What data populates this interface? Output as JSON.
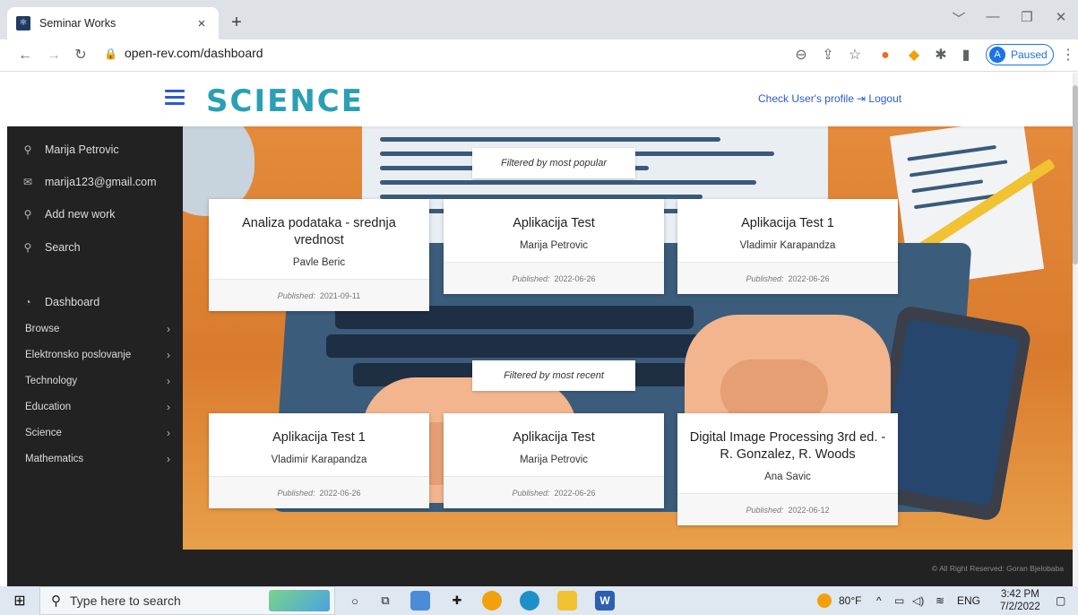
{
  "browser": {
    "tab_title": "Seminar Works",
    "tab_close": "×",
    "new_tab": "+",
    "window_controls": [
      "﹀",
      "—",
      "❐",
      "✕"
    ],
    "url": "open-rev.com/dashboard",
    "profile_initial": "A",
    "profile_status": "Paused",
    "icons": [
      "back-arrow-icon",
      "forward-arrow-icon",
      "reload-icon",
      "lock-icon",
      "zoom-icon",
      "share-icon",
      "star-icon",
      "extension-icon",
      "puzzle-icon",
      "sidebar-icon",
      "menu-dots-icon"
    ]
  },
  "header": {
    "logo": "SCIENCE",
    "profile_link": "Check User's profile",
    "logout_link": "Logout"
  },
  "sidebar": {
    "user": [
      {
        "icon": "link-icon",
        "label": "Marija Petrovic"
      },
      {
        "icon": "mail-icon",
        "label": "marija123@gmail.com"
      },
      {
        "icon": "link-icon",
        "label": "Add new work"
      },
      {
        "icon": "search-icon",
        "label": "Search"
      }
    ],
    "dashboard": "Dashboard",
    "categories": [
      {
        "label": "Browse",
        "chevron": "›"
      },
      {
        "label": "Elektronsko poslovanje",
        "chevron": "›"
      },
      {
        "label": "Technology",
        "chevron": "›"
      },
      {
        "label": "Education",
        "chevron": "›"
      },
      {
        "label": "Science",
        "chevron": "›"
      },
      {
        "label": "Mathematics",
        "chevron": "›"
      }
    ]
  },
  "main": {
    "popular": {
      "label": "Filtered by most popular",
      "cards": [
        {
          "title": "Analiza podataka - srednja vrednost",
          "author": "Pavle Beric",
          "published_label": "Published:",
          "date": "2021-09-11"
        },
        {
          "title": "Aplikacija Test",
          "author": "Marija Petrovic",
          "published_label": "Published:",
          "date": "2022-06-26"
        },
        {
          "title": "Aplikacija Test 1",
          "author": "Vladimir Karapandza",
          "published_label": "Published:",
          "date": "2022-06-26"
        }
      ]
    },
    "recent": {
      "label": "Filtered by most recent",
      "cards": [
        {
          "title": "Aplikacija Test 1",
          "author": "Vladimir Karapandza",
          "published_label": "Published:",
          "date": "2022-06-26"
        },
        {
          "title": "Aplikacija Test",
          "author": "Marija Petrovic",
          "published_label": "Published:",
          "date": "2022-06-26"
        },
        {
          "title": "Digital Image Processing 3rd ed. - R. Gonzalez, R. Woods",
          "author": "Ana Savic",
          "published_label": "Published:",
          "date": "2022-06-12"
        }
      ]
    }
  },
  "footer": {
    "copyright": "© All Right Reserved: Goran Bjelobaba"
  },
  "taskbar": {
    "search_placeholder": "Type here to search",
    "weather": "80°F",
    "language": "ENG",
    "time": "3:42 PM",
    "date": "7/2/2022"
  }
}
